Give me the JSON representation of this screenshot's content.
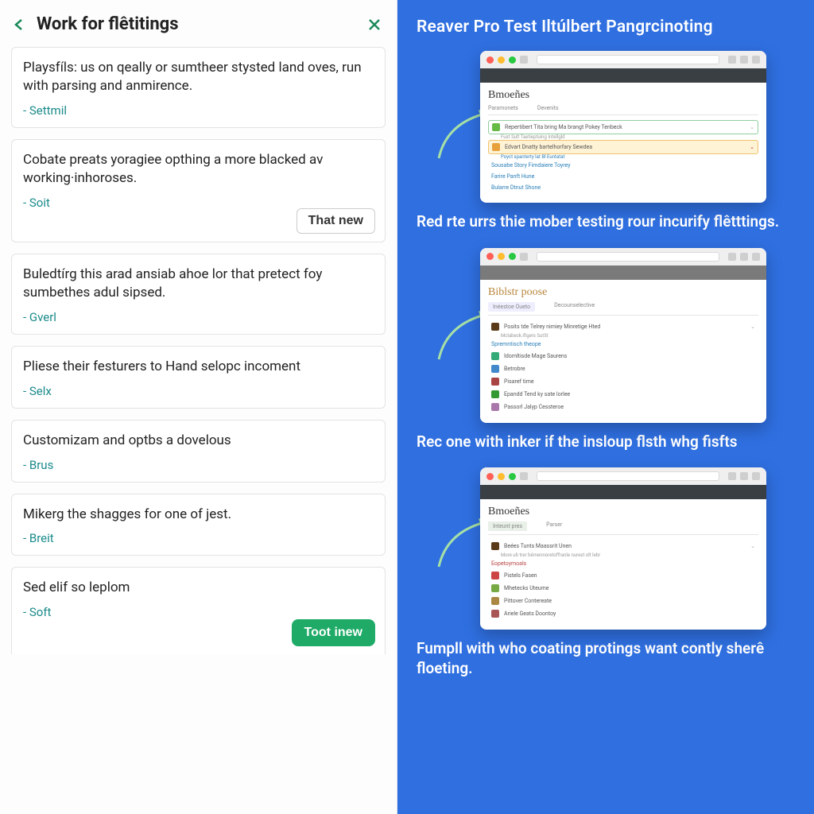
{
  "left": {
    "title": "Work for flêtitings",
    "cards": [
      {
        "body": "Playsfíls: us on qeally or sumtheer stysted land oves, run with parsing and anmirence.",
        "tag": "Settmil"
      },
      {
        "body": "Cobate preats yoragiee opthing a more blacked av working·inhoroses.",
        "tag": "Soit",
        "button_outline": "That new"
      },
      {
        "body": "Buledtírg this arad ansiab ahoe lor that pretect foy sumbethes adul sipsed.",
        "tag": "Gverl"
      },
      {
        "body": "Pliese their festurers to Hand selopс incoment",
        "tag": "Selx"
      },
      {
        "body": "Customizam and optbs a dovelous",
        "tag": "Brus"
      },
      {
        "body": "Mikerg the shagges for one of jest.",
        "tag": "Breit"
      },
      {
        "body": "Sed elif so leplom",
        "tag": "Soft",
        "button_solid": "Toot inew"
      }
    ]
  },
  "right": {
    "title": "Reaver Pro Test Iltúlbert Pangrcinoting",
    "captions": [
      "Red rte urrs thie mober testing rour incurify flêtttings.",
      "Reс one with inker if the insloup flsth whg fisfts",
      "Fumpll with who coating protings want contly sherê floeting."
    ],
    "thumbs": [
      {
        "brand": "Bmoeñes"
      },
      {
        "brand": "Biblstr poose"
      },
      {
        "brand": "Bmoeñes"
      }
    ]
  }
}
